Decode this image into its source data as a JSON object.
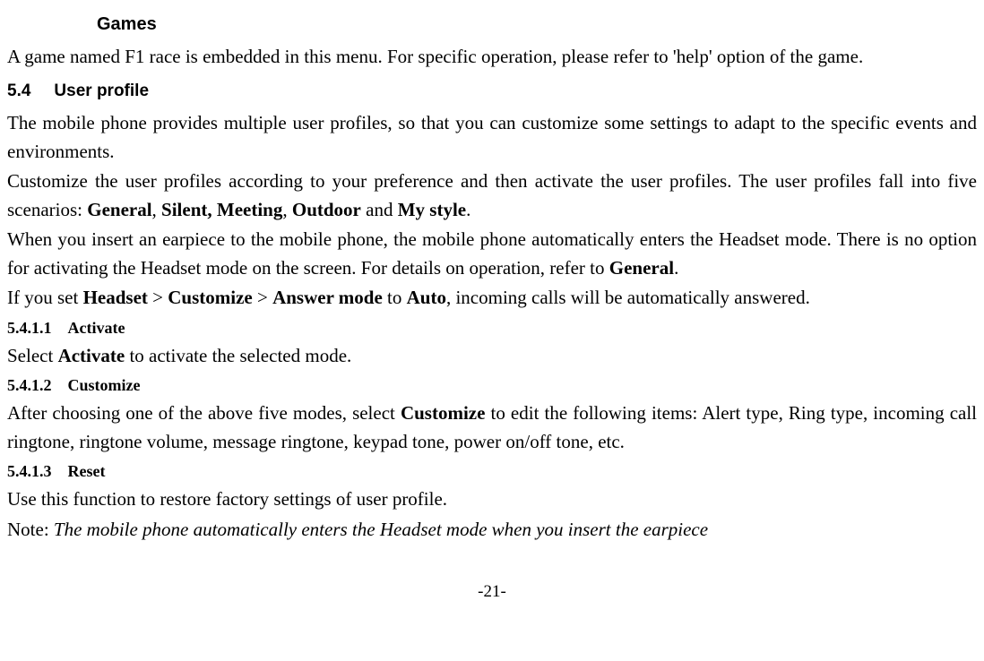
{
  "heading_games": "Games",
  "p_games": "A game named F1 race is embedded in this menu. For specific operation, please refer to 'help' option of the game.",
  "section_54_num": "5.4",
  "section_54_title": "User profile",
  "p_up_1": "The mobile phone provides multiple user profiles, so that you can customize some settings to adapt to the specific events and environments.",
  "p_up_2a": "Customize the user profiles according to your preference and then activate the user profiles. The user profiles fall into five scenarios: ",
  "b_general": "General",
  "p_up_2_comma1": ", ",
  "b_silent_meeting": "Silent, Meeting",
  "p_up_2_comma2": ", ",
  "b_outdoor": "Outdoor",
  "p_up_2_and": " and ",
  "b_mystyle": "My style",
  "p_up_2_period": ".",
  "p_up_3a": "When you insert an earpiece to the mobile phone, the mobile phone automatically enters the Headset mode. There is no option for activating the Headset mode on the screen. For details on operation, refer to ",
  "b_general2": "General",
  "p_up_3_period": ".",
  "p_up_4a": "If you set ",
  "b_headset": "Headset",
  "p_up_4_gt1": " > ",
  "b_customize": "Customize",
  "p_up_4_gt2": " > ",
  "b_answermode": "Answer mode",
  "p_up_4_to": " to ",
  "b_auto": "Auto",
  "p_up_4_rest": ", incoming calls will be automatically answered.",
  "sub_5411_num": "5.4.1.1",
  "sub_5411_title": "Activate",
  "p_5411_a": "Select ",
  "b_activate": "Activate",
  "p_5411_b": " to activate the selected mode.",
  "sub_5412_num": "5.4.1.2",
  "sub_5412_title": "Customize",
  "p_5412_a": "After choosing one of the above five modes, select ",
  "b_customize2": "Customize",
  "p_5412_b": " to edit the following items: Alert type, Ring type, incoming call ringtone, ringtone volume, message ringtone, keypad tone, power on/off tone, etc.",
  "sub_5413_num": "5.4.1.3",
  "sub_5413_title": "Reset",
  "p_5413": "Use this function to restore factory settings of user profile.",
  "p_note_label": "Note: ",
  "p_note_body": "The mobile phone automatically enters the Headset mode when you insert the earpiece",
  "page_number": "-21-"
}
